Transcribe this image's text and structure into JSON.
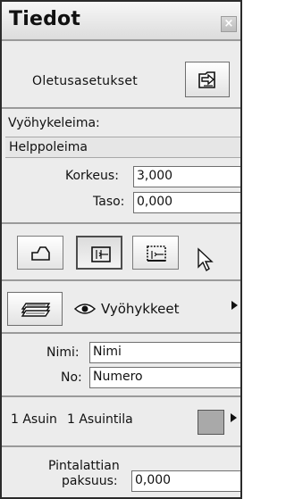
{
  "window": {
    "title": "Tiedot",
    "close_glyph": "×"
  },
  "defaults": {
    "label": "Oletusasetukset",
    "icon": "defaults-settings-icon"
  },
  "zone_stamp": {
    "label": "Vyöhykeleima:",
    "value": "Helppoleima"
  },
  "height": {
    "label": "Korkeus:",
    "value": "3,000"
  },
  "level": {
    "label": "Taso:",
    "value": "0,000"
  },
  "geometry_methods": [
    {
      "icon": "polygon-outline-icon",
      "selected": false
    },
    {
      "icon": "rectangle-icon",
      "selected": true
    },
    {
      "icon": "rotated-rectangle-icon",
      "selected": false
    }
  ],
  "layer": {
    "icon": "layers-icon",
    "visibility_icon": "eye-icon",
    "name": "Vyöhykkeet"
  },
  "zone_name": {
    "label": "Nimi:",
    "value": "Nimi"
  },
  "zone_number": {
    "label": "No:",
    "value": "Numero"
  },
  "category": {
    "code": "1 Asuin",
    "name": "1 Asuintila",
    "swatch_color": "#a9a9a9"
  },
  "floor_thickness": {
    "label_line1": "Pintalattian",
    "label_line2": "paksuus:",
    "value": "0,000"
  }
}
